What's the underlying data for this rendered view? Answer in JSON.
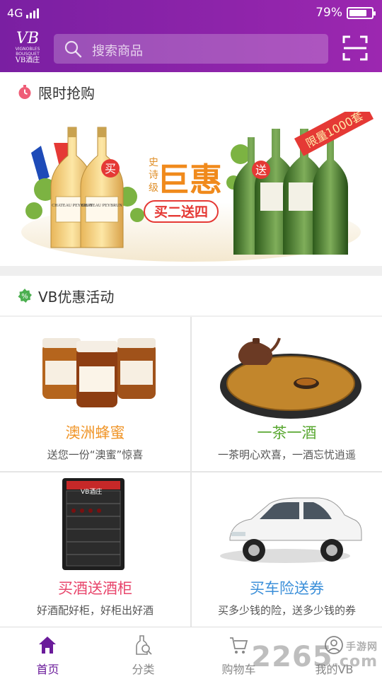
{
  "status_bar": {
    "network": "4G",
    "battery": "79%",
    "battery_level": 0.79
  },
  "header": {
    "logo_mark": "VB",
    "logo_tiny": "VIGNOBLES BOUSQUET",
    "logo_name": "VB酒庄",
    "search_placeholder": "搜索商品"
  },
  "flash_sale": {
    "title": "限时抢购",
    "banner": {
      "tag_limit": "限量1000套",
      "buy_badge": "买",
      "gift_badge": "送",
      "epic": "史诗级",
      "big": "巨惠",
      "offer": "买二送四",
      "label_left": "CHATEAU PEYBRUN"
    }
  },
  "promotions": {
    "title": "VB优惠活动",
    "items": [
      {
        "title": "澳洲蜂蜜",
        "subtitle": "送您一份“澳蜜”惊喜",
        "color": "#f0962a"
      },
      {
        "title": "一茶一酒",
        "subtitle": "一茶明心欢喜，一酒忘忧逍遥",
        "color": "#5aa832"
      },
      {
        "title": "买酒送酒柜",
        "subtitle": "好酒配好柜，好柜出好酒",
        "color": "#e8456b"
      },
      {
        "title": "买车险送券",
        "subtitle": "买多少钱的险，送多少钱的券",
        "color": "#3b8fd9"
      }
    ],
    "fridge_label": "VB酒庄"
  },
  "bottom_nav": [
    {
      "label": "首页",
      "icon": "home-icon",
      "active": true
    },
    {
      "label": "分类",
      "icon": "bottle-search-icon",
      "active": false
    },
    {
      "label": "购物车",
      "icon": "cart-icon",
      "active": false
    },
    {
      "label": "我的VB",
      "icon": "user-icon",
      "active": false
    }
  ],
  "watermark": {
    "brand": "2265",
    "suffix": "手游网",
    "domain": ".com"
  },
  "colors": {
    "primary": "#8e24aa",
    "active_nav": "#6a1b9a"
  }
}
